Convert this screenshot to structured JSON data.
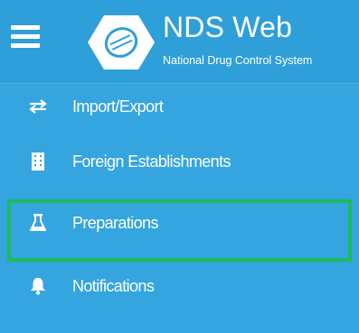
{
  "header": {
    "title": "NDS Web",
    "subtitle": "National Drug Control System",
    "menu_icon": "hamburger-menu-icon",
    "logo_icon": "pill-capsule-logo"
  },
  "menu": {
    "items": [
      {
        "label": "Import/Export",
        "icon": "exchange-arrows-icon"
      },
      {
        "label": "Foreign Establishments",
        "icon": "building-icon"
      },
      {
        "label": "Preparations",
        "icon": "flask-icon",
        "highlighted": true
      },
      {
        "label": "Notifications",
        "icon": "bell-icon"
      }
    ]
  },
  "colors": {
    "sidebar_bg": "#34a5df",
    "header_bg": "#2f9fd9",
    "text": "#ffffff",
    "highlight_border": "#1dbb5c"
  }
}
